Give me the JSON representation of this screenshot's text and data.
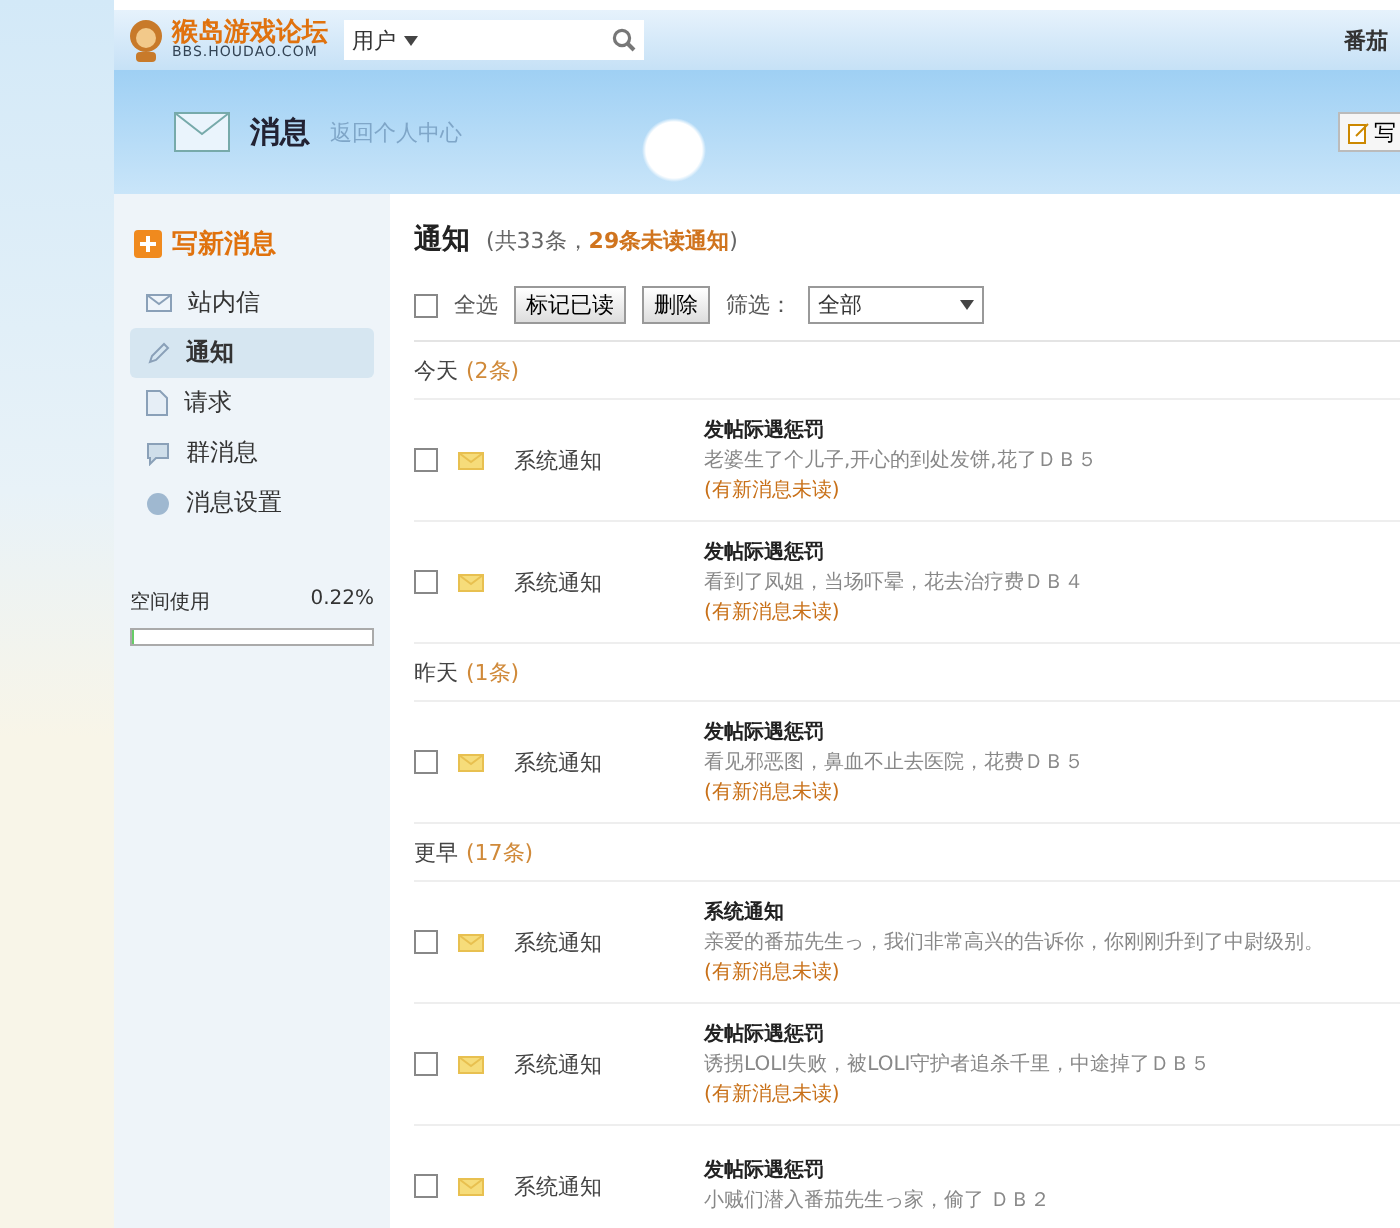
{
  "header": {
    "logo": "猴岛游戏论坛",
    "logo_sub": "BBS.HOUDAO.COM",
    "search": {
      "scope": "用户"
    },
    "user": "番茄"
  },
  "banner": {
    "title": "消息",
    "link": "返回个人中心",
    "corner_button": "写"
  },
  "sidebar": {
    "compose": "写新消息",
    "items": [
      {
        "label": "站内信",
        "selected": false
      },
      {
        "label": "通知",
        "selected": true
      },
      {
        "label": "请求",
        "selected": false
      },
      {
        "label": "群消息",
        "selected": false
      },
      {
        "label": "消息设置",
        "selected": false
      }
    ],
    "space": {
      "label": "空间使用",
      "reading": "0.22%",
      "level": 0.0022
    }
  },
  "main": {
    "title": "通知",
    "summary": "(共33条，**29条未读通知**)",
    "toolbar": {
      "select_all": {
        "label": "全选",
        "checked": false
      },
      "buttons": [
        "标记已读",
        "删除"
      ],
      "filter_label": "筛选：",
      "filter_value": "全部"
    },
    "groups": [
      {
        "label": "今天",
        "count": "(2条)",
        "items": [
          {
            "checked": false,
            "sender": "系统通知",
            "title": "发帖际遇惩罚",
            "body": "老婆生了个儿子,开心的到处发饼,花了ＤＢ５",
            "note": "(有新消息未读)"
          },
          {
            "checked": false,
            "sender": "系统通知",
            "title": "发帖际遇惩罚",
            "body": "看到了凤姐，当场吓晕，花去治疗费ＤＢ４",
            "note": "(有新消息未读)"
          }
        ]
      },
      {
        "label": "昨天",
        "count": "(1条)",
        "items": [
          {
            "checked": false,
            "sender": "系统通知",
            "title": "发帖际遇惩罚",
            "body": "看见邪恶图，鼻血不止去医院，花费ＤＢ５",
            "note": "(有新消息未读)"
          }
        ]
      },
      {
        "label": "更早",
        "count": "(17条)",
        "items": [
          {
            "checked": false,
            "sender": "系统通知",
            "title": "系统通知",
            "body": "亲爱的番茄先生っ，我们非常高兴的告诉你，你刚刚升到了中尉级别。",
            "note": "(有新消息未读)"
          },
          {
            "checked": false,
            "sender": "系统通知",
            "title": "发帖际遇惩罚",
            "body": "诱拐LOLI失败，被LOLI守护者追杀千里，中途掉了ＤＢ５",
            "note": "(有新消息未读)"
          },
          {
            "checked": false,
            "sender": "系统通知",
            "title": "发帖际遇惩罚",
            "body": "小贼们潜入番茄先生っ家，偷了 ＤＢ２"
          }
        ]
      }
    ]
  }
}
